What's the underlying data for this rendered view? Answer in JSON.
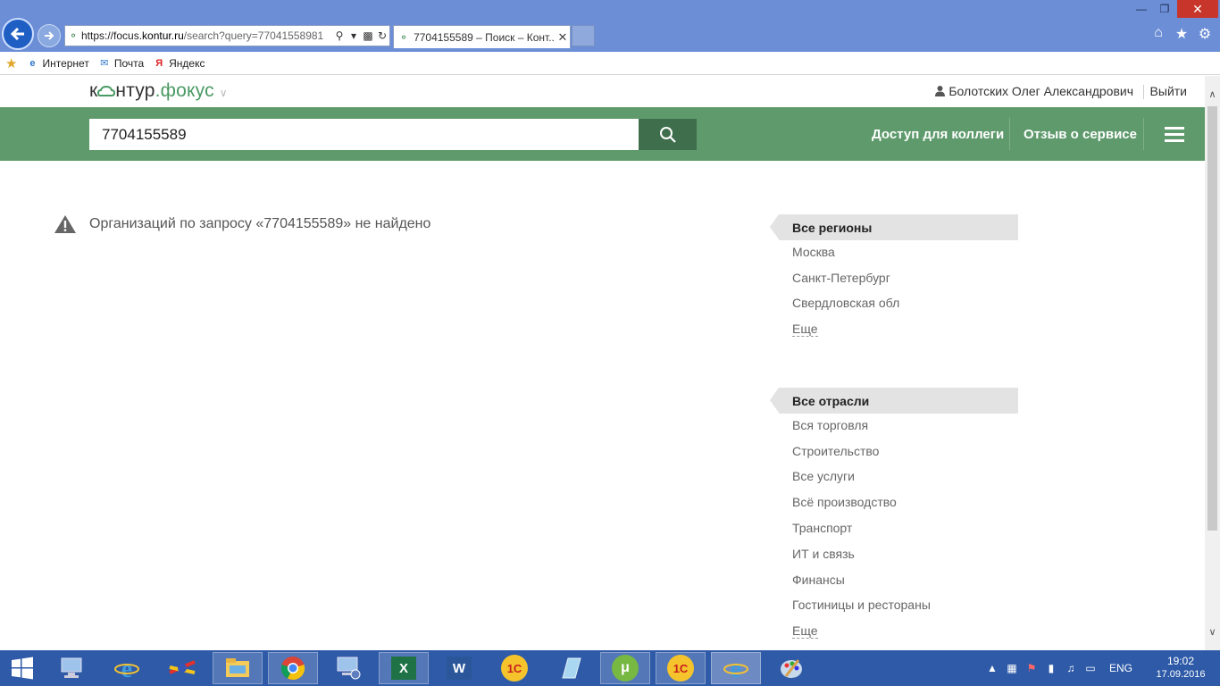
{
  "browser": {
    "address_url_prefix": "https://focus.",
    "address_url_domain": "kontur.ru",
    "address_url_rest": "/search?query=77041558981",
    "tab_title": "7704155589 – Поиск – Конт...",
    "favorites": [
      {
        "label": "Интернет",
        "icon": "ie-icon"
      },
      {
        "label": "Почта",
        "icon": "mail-icon"
      },
      {
        "label": "Яндекс",
        "icon": "yandex-icon"
      }
    ]
  },
  "site": {
    "logo_part1": "к",
    "logo_part2": "нтур",
    "logo_part3": ".фокус",
    "user_name": "Болотских Олег Александрович",
    "logout_label": "Выйти",
    "search_value": "7704155589",
    "nav_colleague": "Доступ для коллеги",
    "nav_feedback": "Отзыв о сервисе"
  },
  "result": {
    "message": "Организаций по запросу «7704155589» не найдено"
  },
  "regions": {
    "header": "Все регионы",
    "items": [
      "Москва",
      "Санкт-Петербург",
      "Свердловская обл"
    ],
    "more": "Еще"
  },
  "industries": {
    "header": "Все отрасли",
    "items": [
      "Вся торговля",
      "Строительство",
      "Все услуги",
      "Всё производство",
      "Транспорт",
      "ИТ и связь",
      "Финансы",
      "Гостиницы и рестораны"
    ],
    "more": "Еще"
  },
  "taskbar": {
    "excel_label": "X",
    "word_label": "W",
    "onec_label": "1С",
    "onec2_label": "1С",
    "lang": "ENG",
    "time": "19:02",
    "date": "17.09.2016"
  },
  "colors": {
    "green_bar": "#5e9a6c",
    "search_button": "#3f6e4c",
    "taskbar": "#2e5aa8"
  }
}
